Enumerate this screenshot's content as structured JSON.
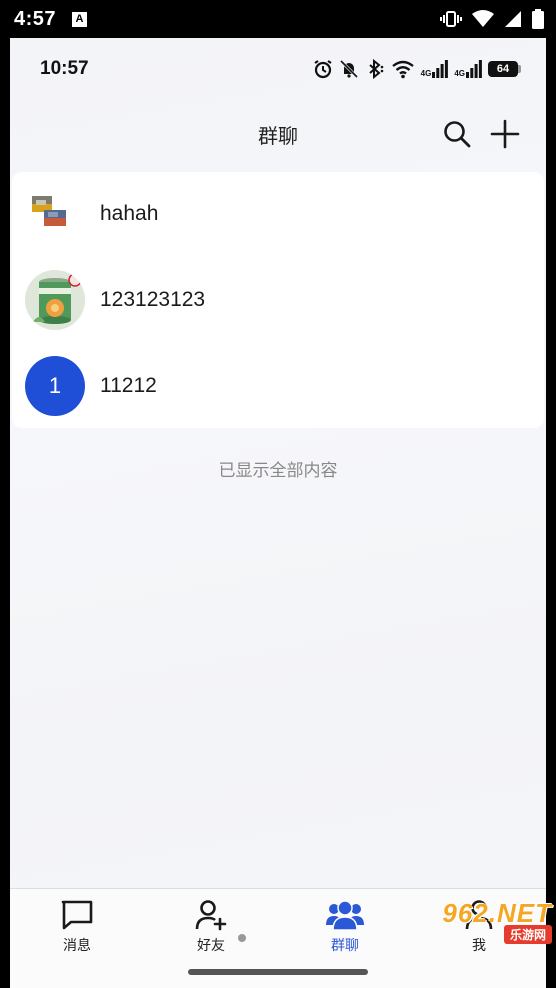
{
  "system_bar": {
    "time": "4:57",
    "notification_letter": "A"
  },
  "inner_status": {
    "time": "10:57",
    "network_label_1": "4G",
    "network_label_2": "4G",
    "battery": "64"
  },
  "header": {
    "title": "群聊",
    "search_icon": "search-icon",
    "add_icon": "plus-icon"
  },
  "groups": [
    {
      "name": "hahah",
      "avatar": "image-collage"
    },
    {
      "name": "123123123",
      "avatar": "product-photo"
    },
    {
      "name": "11212",
      "avatar_letter": "1",
      "avatar_color": "#1f4fd6"
    }
  ],
  "end_note": "已显示全部内容",
  "tabs": [
    {
      "label": "消息",
      "icon": "chat-bubble-icon",
      "active": false
    },
    {
      "label": "好友",
      "icon": "add-user-icon",
      "active": false
    },
    {
      "label": "群聊",
      "icon": "group-icon",
      "active": true
    },
    {
      "label": "我",
      "icon": "person-icon",
      "active": false
    }
  ],
  "colors": {
    "accent": "#2a58d6",
    "avatar_blue": "#1f4fd6"
  },
  "watermark": {
    "logo": "962.NET",
    "sub": "乐游网"
  }
}
